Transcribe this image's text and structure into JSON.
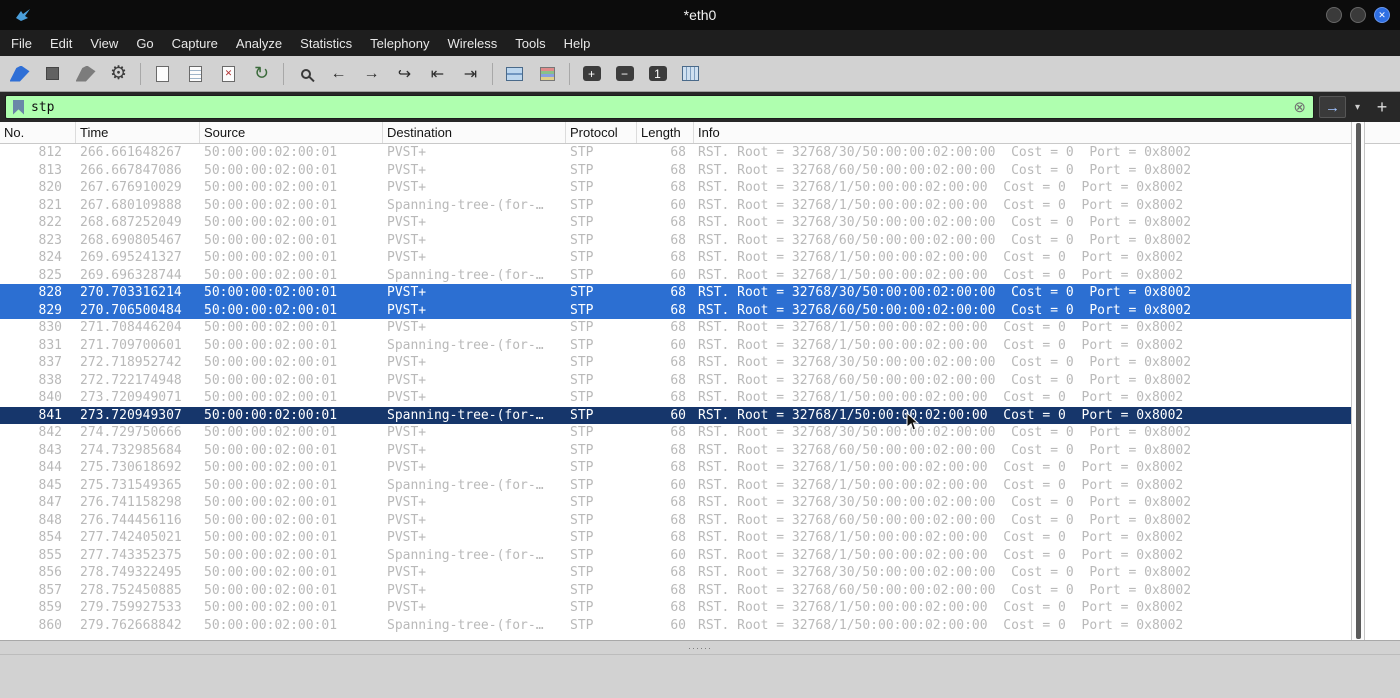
{
  "window": {
    "title": "*eth0"
  },
  "menu": {
    "items": [
      "File",
      "Edit",
      "View",
      "Go",
      "Capture",
      "Analyze",
      "Statistics",
      "Telephony",
      "Wireless",
      "Tools",
      "Help"
    ]
  },
  "toolbar": {
    "buttons": [
      {
        "name": "start-capture-button",
        "icon": "shark-fin-icon"
      },
      {
        "name": "stop-capture-button",
        "icon": "stop-square-icon"
      },
      {
        "name": "restart-capture-button",
        "icon": "shark-fin-gray-icon"
      },
      {
        "name": "capture-options-button",
        "icon": "gear-icon",
        "glyph": "⚙"
      },
      {
        "type": "separator"
      },
      {
        "name": "open-file-button",
        "icon": "document-icon"
      },
      {
        "name": "save-file-button",
        "icon": "document-lines-icon"
      },
      {
        "name": "close-file-button",
        "icon": "document-close-icon",
        "glyph": "✕"
      },
      {
        "name": "reload-file-button",
        "icon": "reload-icon",
        "glyph": "↻"
      },
      {
        "type": "separator"
      },
      {
        "name": "find-packet-button",
        "icon": "magnifier-icon"
      },
      {
        "name": "go-back-button",
        "icon": "arrow-left-icon",
        "glyph": "←"
      },
      {
        "name": "go-forward-button",
        "icon": "arrow-right-icon",
        "glyph": "→"
      },
      {
        "name": "go-to-packet-button",
        "icon": "goto-arrow-icon",
        "glyph": "↪"
      },
      {
        "name": "go-first-packet-button",
        "icon": "arrow-bar-left-icon",
        "glyph": "⇤"
      },
      {
        "name": "go-last-packet-button",
        "icon": "arrow-bar-right-icon",
        "glyph": "⇥"
      },
      {
        "type": "separator"
      },
      {
        "name": "autoscroll-button",
        "icon": "autoscroll-icon"
      },
      {
        "name": "colorize-button",
        "icon": "colorize-icon"
      },
      {
        "type": "separator"
      },
      {
        "name": "zoom-in-button",
        "icon": "zoom-in-key-icon",
        "glyph": "+",
        "dark": true
      },
      {
        "name": "zoom-out-button",
        "icon": "zoom-out-key-icon",
        "glyph": "−",
        "dark": true
      },
      {
        "name": "zoom-original-button",
        "icon": "zoom-100-key-icon",
        "glyph": "1",
        "dark": true
      },
      {
        "name": "resize-columns-button",
        "icon": "columns-icon"
      }
    ]
  },
  "filter": {
    "value": "stp"
  },
  "icons": {
    "clear": "⊗",
    "apply": "→",
    "caret": "▾",
    "add": "+",
    "close_window": "✕"
  },
  "splitter": {
    "dots": "······"
  },
  "colors": {
    "filter_valid_bg": "#afffaf",
    "selected_row_bg": "#2c6fd2",
    "current_row_bg": "#16366b",
    "stp_row_text": "#b9b9b9"
  },
  "packet_list": {
    "columns": [
      "No.",
      "Time",
      "Source",
      "Destination",
      "Protocol",
      "Length",
      "Info"
    ],
    "rows": [
      {
        "no": "812",
        "time": "266.661648267",
        "source": "50:00:00:02:00:01",
        "destination": "PVST+",
        "protocol": "STP",
        "length": "68",
        "info": "RST. Root = 32768/30/50:00:00:02:00:00  Cost = 0  Port = 0x8002",
        "state": "normal"
      },
      {
        "no": "813",
        "time": "266.667847086",
        "source": "50:00:00:02:00:01",
        "destination": "PVST+",
        "protocol": "STP",
        "length": "68",
        "info": "RST. Root = 32768/60/50:00:00:02:00:00  Cost = 0  Port = 0x8002",
        "state": "normal"
      },
      {
        "no": "820",
        "time": "267.676910029",
        "source": "50:00:00:02:00:01",
        "destination": "PVST+",
        "protocol": "STP",
        "length": "68",
        "info": "RST. Root = 32768/1/50:00:00:02:00:00  Cost = 0  Port = 0x8002",
        "state": "normal"
      },
      {
        "no": "821",
        "time": "267.680109888",
        "source": "50:00:00:02:00:01",
        "destination": "Spanning-tree-(for-…",
        "protocol": "STP",
        "length": "60",
        "info": "RST. Root = 32768/1/50:00:00:02:00:00  Cost = 0  Port = 0x8002",
        "state": "normal"
      },
      {
        "no": "822",
        "time": "268.687252049",
        "source": "50:00:00:02:00:01",
        "destination": "PVST+",
        "protocol": "STP",
        "length": "68",
        "info": "RST. Root = 32768/30/50:00:00:02:00:00  Cost = 0  Port = 0x8002",
        "state": "normal"
      },
      {
        "no": "823",
        "time": "268.690805467",
        "source": "50:00:00:02:00:01",
        "destination": "PVST+",
        "protocol": "STP",
        "length": "68",
        "info": "RST. Root = 32768/60/50:00:00:02:00:00  Cost = 0  Port = 0x8002",
        "state": "normal"
      },
      {
        "no": "824",
        "time": "269.695241327",
        "source": "50:00:00:02:00:01",
        "destination": "PVST+",
        "protocol": "STP",
        "length": "68",
        "info": "RST. Root = 32768/1/50:00:00:02:00:00  Cost = 0  Port = 0x8002",
        "state": "normal"
      },
      {
        "no": "825",
        "time": "269.696328744",
        "source": "50:00:00:02:00:01",
        "destination": "Spanning-tree-(for-…",
        "protocol": "STP",
        "length": "60",
        "info": "RST. Root = 32768/1/50:00:00:02:00:00  Cost = 0  Port = 0x8002",
        "state": "normal"
      },
      {
        "no": "828",
        "time": "270.703316214",
        "source": "50:00:00:02:00:01",
        "destination": "PVST+",
        "protocol": "STP",
        "length": "68",
        "info": "RST. Root = 32768/30/50:00:00:02:00:00  Cost = 0  Port = 0x8002",
        "state": "selected"
      },
      {
        "no": "829",
        "time": "270.706500484",
        "source": "50:00:00:02:00:01",
        "destination": "PVST+",
        "protocol": "STP",
        "length": "68",
        "info": "RST. Root = 32768/60/50:00:00:02:00:00  Cost = 0  Port = 0x8002",
        "state": "selected"
      },
      {
        "no": "830",
        "time": "271.708446204",
        "source": "50:00:00:02:00:01",
        "destination": "PVST+",
        "protocol": "STP",
        "length": "68",
        "info": "RST. Root = 32768/1/50:00:00:02:00:00  Cost = 0  Port = 0x8002",
        "state": "normal"
      },
      {
        "no": "831",
        "time": "271.709700601",
        "source": "50:00:00:02:00:01",
        "destination": "Spanning-tree-(for-…",
        "protocol": "STP",
        "length": "60",
        "info": "RST. Root = 32768/1/50:00:00:02:00:00  Cost = 0  Port = 0x8002",
        "state": "normal"
      },
      {
        "no": "837",
        "time": "272.718952742",
        "source": "50:00:00:02:00:01",
        "destination": "PVST+",
        "protocol": "STP",
        "length": "68",
        "info": "RST. Root = 32768/30/50:00:00:02:00:00  Cost = 0  Port = 0x8002",
        "state": "normal"
      },
      {
        "no": "838",
        "time": "272.722174948",
        "source": "50:00:00:02:00:01",
        "destination": "PVST+",
        "protocol": "STP",
        "length": "68",
        "info": "RST. Root = 32768/60/50:00:00:02:00:00  Cost = 0  Port = 0x8002",
        "state": "normal"
      },
      {
        "no": "840",
        "time": "273.720949071",
        "source": "50:00:00:02:00:01",
        "destination": "PVST+",
        "protocol": "STP",
        "length": "68",
        "info": "RST. Root = 32768/1/50:00:00:02:00:00  Cost = 0  Port = 0x8002",
        "state": "normal"
      },
      {
        "no": "841",
        "time": "273.720949307",
        "source": "50:00:00:02:00:01",
        "destination": "Spanning-tree-(for-…",
        "protocol": "STP",
        "length": "60",
        "info": "RST. Root = 32768/1/50:00:00:02:00:00  Cost = 0  Port = 0x8002",
        "state": "current"
      },
      {
        "no": "842",
        "time": "274.729750666",
        "source": "50:00:00:02:00:01",
        "destination": "PVST+",
        "protocol": "STP",
        "length": "68",
        "info": "RST. Root = 32768/30/50:00:00:02:00:00  Cost = 0  Port = 0x8002",
        "state": "normal"
      },
      {
        "no": "843",
        "time": "274.732985684",
        "source": "50:00:00:02:00:01",
        "destination": "PVST+",
        "protocol": "STP",
        "length": "68",
        "info": "RST. Root = 32768/60/50:00:00:02:00:00  Cost = 0  Port = 0x8002",
        "state": "normal"
      },
      {
        "no": "844",
        "time": "275.730618692",
        "source": "50:00:00:02:00:01",
        "destination": "PVST+",
        "protocol": "STP",
        "length": "68",
        "info": "RST. Root = 32768/1/50:00:00:02:00:00  Cost = 0  Port = 0x8002",
        "state": "normal"
      },
      {
        "no": "845",
        "time": "275.731549365",
        "source": "50:00:00:02:00:01",
        "destination": "Spanning-tree-(for-…",
        "protocol": "STP",
        "length": "60",
        "info": "RST. Root = 32768/1/50:00:00:02:00:00  Cost = 0  Port = 0x8002",
        "state": "normal"
      },
      {
        "no": "847",
        "time": "276.741158298",
        "source": "50:00:00:02:00:01",
        "destination": "PVST+",
        "protocol": "STP",
        "length": "68",
        "info": "RST. Root = 32768/30/50:00:00:02:00:00  Cost = 0  Port = 0x8002",
        "state": "normal"
      },
      {
        "no": "848",
        "time": "276.744456116",
        "source": "50:00:00:02:00:01",
        "destination": "PVST+",
        "protocol": "STP",
        "length": "68",
        "info": "RST. Root = 32768/60/50:00:00:02:00:00  Cost = 0  Port = 0x8002",
        "state": "normal"
      },
      {
        "no": "854",
        "time": "277.742405021",
        "source": "50:00:00:02:00:01",
        "destination": "PVST+",
        "protocol": "STP",
        "length": "68",
        "info": "RST. Root = 32768/1/50:00:00:02:00:00  Cost = 0  Port = 0x8002",
        "state": "normal"
      },
      {
        "no": "855",
        "time": "277.743352375",
        "source": "50:00:00:02:00:01",
        "destination": "Spanning-tree-(for-…",
        "protocol": "STP",
        "length": "60",
        "info": "RST. Root = 32768/1/50:00:00:02:00:00  Cost = 0  Port = 0x8002",
        "state": "normal"
      },
      {
        "no": "856",
        "time": "278.749322495",
        "source": "50:00:00:02:00:01",
        "destination": "PVST+",
        "protocol": "STP",
        "length": "68",
        "info": "RST. Root = 32768/30/50:00:00:02:00:00  Cost = 0  Port = 0x8002",
        "state": "normal"
      },
      {
        "no": "857",
        "time": "278.752450885",
        "source": "50:00:00:02:00:01",
        "destination": "PVST+",
        "protocol": "STP",
        "length": "68",
        "info": "RST. Root = 32768/60/50:00:00:02:00:00  Cost = 0  Port = 0x8002",
        "state": "normal"
      },
      {
        "no": "859",
        "time": "279.759927533",
        "source": "50:00:00:02:00:01",
        "destination": "PVST+",
        "protocol": "STP",
        "length": "68",
        "info": "RST. Root = 32768/1/50:00:00:02:00:00  Cost = 0  Port = 0x8002",
        "state": "normal"
      },
      {
        "no": "860",
        "time": "279.762668842",
        "source": "50:00:00:02:00:01",
        "destination": "Spanning-tree-(for-…",
        "protocol": "STP",
        "length": "60",
        "info": "RST. Root = 32768/1/50:00:00:02:00:00  Cost = 0  Port = 0x8002",
        "state": "normal"
      }
    ]
  }
}
